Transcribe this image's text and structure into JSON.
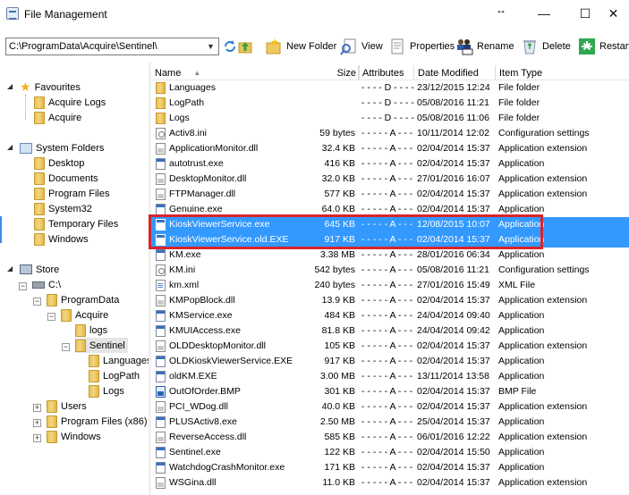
{
  "window": {
    "title": "File Management",
    "controls": {
      "resize": "↔",
      "minimize": "—",
      "maximize": "☐",
      "close": "✕"
    }
  },
  "toolbar": {
    "path_value": "C:\\ProgramData\\Acquire\\Sentinel\\",
    "new_folder": "New Folder",
    "view": "View",
    "properties": "Properties",
    "rename": "Rename",
    "delete": "Delete",
    "restart": "Restart"
  },
  "tree": {
    "favourites": "Favourites",
    "acquire_logs": "Acquire Logs",
    "acquire": "Acquire",
    "system_folders": "System Folders",
    "desktop": "Desktop",
    "documents": "Documents",
    "program_files": "Program Files",
    "system32": "System32",
    "temporary_files": "Temporary Files",
    "windows": "Windows",
    "store": "Store",
    "c_drive": "C:\\",
    "programdata": "ProgramData",
    "acquire_dir": "Acquire",
    "logs": "logs",
    "sentinel": "Sentinel",
    "languages": "Languages",
    "logpath": "LogPath",
    "logs_sub": "Logs",
    "users": "Users",
    "program_files_x86": "Program Files (x86)",
    "windows_dir": "Windows"
  },
  "columns": {
    "name": "Name",
    "size": "Size",
    "attributes": "Attributes",
    "date_modified": "Date Modified",
    "item_type": "Item Type"
  },
  "files": [
    {
      "name": "Languages",
      "size": "",
      "attr": "- - - - D - - - -",
      "date": "23/12/2015 12:24",
      "type": "File folder",
      "icon": "folder-icon"
    },
    {
      "name": "LogPath",
      "size": "",
      "attr": "- - - - D - - - -",
      "date": "05/08/2016 11:21",
      "type": "File folder",
      "icon": "folder-icon"
    },
    {
      "name": "Logs",
      "size": "",
      "attr": "- - - - D - - - -",
      "date": "05/08/2016 11:06",
      "type": "File folder",
      "icon": "folder-icon"
    },
    {
      "name": "Activ8.ini",
      "size": "59 bytes",
      "attr": "- - - - - A - - -",
      "date": "10/11/2014 12:02",
      "type": "Configuration settings",
      "icon": "config-file-icon"
    },
    {
      "name": "ApplicationMonitor.dll",
      "size": "32.4 KB",
      "attr": "- - - - - A - - -",
      "date": "02/04/2014 15:37",
      "type": "Application extension",
      "icon": "dll-file-icon"
    },
    {
      "name": "autotrust.exe",
      "size": "416 KB",
      "attr": "- - - - - A - - -",
      "date": "02/04/2014 15:37",
      "type": "Application",
      "icon": "application-icon"
    },
    {
      "name": "DesktopMonitor.dll",
      "size": "32.0 KB",
      "attr": "- - - - - A - - -",
      "date": "27/01/2016 16:07",
      "type": "Application extension",
      "icon": "dll-file-icon"
    },
    {
      "name": "FTPManager.dll",
      "size": "577 KB",
      "attr": "- - - - - A - - -",
      "date": "02/04/2014 15:37",
      "type": "Application extension",
      "icon": "dll-file-icon"
    },
    {
      "name": "Genuine.exe",
      "size": "64.0 KB",
      "attr": "- - - - - A - - -",
      "date": "02/04/2014 15:37",
      "type": "Application",
      "icon": "application-icon"
    },
    {
      "name": "KioskViewerService.exe",
      "size": "645 KB",
      "attr": "- - - - - A - - -",
      "date": "12/08/2015 10:07",
      "type": "Application",
      "icon": "application-icon",
      "selected": true
    },
    {
      "name": "KioskViewerService.old.EXE",
      "size": "917 KB",
      "attr": "- - - - - A - - -",
      "date": "02/04/2014 15:37",
      "type": "Application",
      "icon": "application-icon",
      "selected": true
    },
    {
      "name": "KM.exe",
      "size": "3.38 MB",
      "attr": "- - - - - A - - -",
      "date": "28/01/2016 06:34",
      "type": "Application",
      "icon": "application-icon"
    },
    {
      "name": "KM.ini",
      "size": "542 bytes",
      "attr": "- - - - - A - - -",
      "date": "05/08/2016 11:21",
      "type": "Configuration settings",
      "icon": "config-file-icon"
    },
    {
      "name": "km.xml",
      "size": "240 bytes",
      "attr": "- - - - - A - - -",
      "date": "27/01/2016 15:49",
      "type": "XML File",
      "icon": "xml-file-icon"
    },
    {
      "name": "KMPopBlock.dll",
      "size": "13.9 KB",
      "attr": "- - - - - A - - -",
      "date": "02/04/2014 15:37",
      "type": "Application extension",
      "icon": "dll-file-icon"
    },
    {
      "name": "KMService.exe",
      "size": "484 KB",
      "attr": "- - - - - A - - -",
      "date": "24/04/2014 09:40",
      "type": "Application",
      "icon": "application-icon"
    },
    {
      "name": "KMUIAccess.exe",
      "size": "81.8 KB",
      "attr": "- - - - - A - - -",
      "date": "24/04/2014 09:42",
      "type": "Application",
      "icon": "application-icon"
    },
    {
      "name": "OLDDesktopMonitor.dll",
      "size": "105 KB",
      "attr": "- - - - - A - - -",
      "date": "02/04/2014 15:37",
      "type": "Application extension",
      "icon": "dll-file-icon"
    },
    {
      "name": "OLDKioskViewerService.EXE",
      "size": "917 KB",
      "attr": "- - - - - A - - -",
      "date": "02/04/2014 15:37",
      "type": "Application",
      "icon": "application-icon"
    },
    {
      "name": "oldKM.EXE",
      "size": "3.00 MB",
      "attr": "- - - - - A - - -",
      "date": "13/11/2014 13:58",
      "type": "Application",
      "icon": "application-icon"
    },
    {
      "name": "OutOfOrder.BMP",
      "size": "301 KB",
      "attr": "- - - - - A - - -",
      "date": "02/04/2014 15:37",
      "type": "BMP File",
      "icon": "bmp-file-icon"
    },
    {
      "name": "PCI_WDog.dll",
      "size": "40.0 KB",
      "attr": "- - - - - A - - -",
      "date": "02/04/2014 15:37",
      "type": "Application extension",
      "icon": "dll-file-icon"
    },
    {
      "name": "PLUSActiv8.exe",
      "size": "2.50 MB",
      "attr": "- - - - - A - - -",
      "date": "25/04/2014 15:37",
      "type": "Application",
      "icon": "application-icon"
    },
    {
      "name": "ReverseAccess.dll",
      "size": "585 KB",
      "attr": "- - - - - A - - -",
      "date": "06/01/2016 12:22",
      "type": "Application extension",
      "icon": "dll-file-icon"
    },
    {
      "name": "Sentinel.exe",
      "size": "122 KB",
      "attr": "- - - - - A - - -",
      "date": "02/04/2014 15:50",
      "type": "Application",
      "icon": "application-icon"
    },
    {
      "name": "WatchdogCrashMonitor.exe",
      "size": "171 KB",
      "attr": "- - - - - A - - -",
      "date": "02/04/2014 15:37",
      "type": "Application",
      "icon": "application-icon"
    },
    {
      "name": "WSGina.dll",
      "size": "11.0 KB",
      "attr": "- - - - - A - - -",
      "date": "02/04/2014 15:37",
      "type": "Application extension",
      "icon": "dll-file-icon"
    }
  ],
  "colors": {
    "selection": "#3399ff",
    "highlight_box": "#d9242b"
  }
}
